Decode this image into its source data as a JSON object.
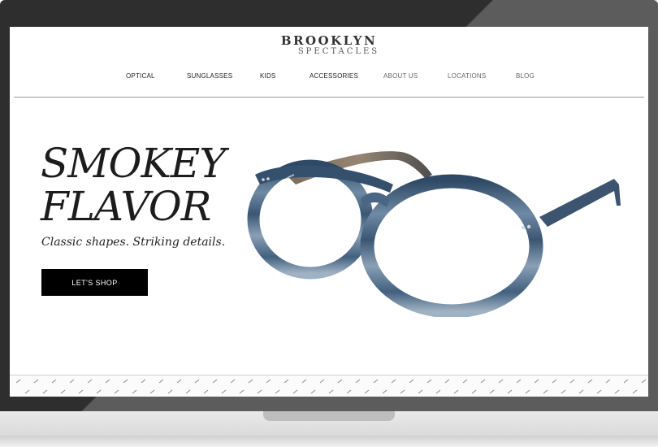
{
  "brand": {
    "name_top": "BROOKLYN",
    "name_bottom": "SPECTACLES"
  },
  "nav": {
    "items": [
      {
        "label": "OPTICAL"
      },
      {
        "label": "SUNGLASSES"
      },
      {
        "label": "KIDS"
      },
      {
        "label": "ACCESSORIES"
      },
      {
        "label": "ABOUT US"
      },
      {
        "label": "LOCATIONS"
      },
      {
        "label": "BLOG"
      }
    ]
  },
  "hero": {
    "title_line1": "SMOKEY",
    "title_line2": "FLAVOR",
    "subtitle": "Classic shapes. Striking details.",
    "cta_label": "LET'S SHOP",
    "product_image": "round-eyeglasses-blue-smoke-frame"
  },
  "colors": {
    "bezel": "#2e2e2e",
    "cta_bg": "#000000",
    "frame_blue": "#3f5f7f"
  }
}
